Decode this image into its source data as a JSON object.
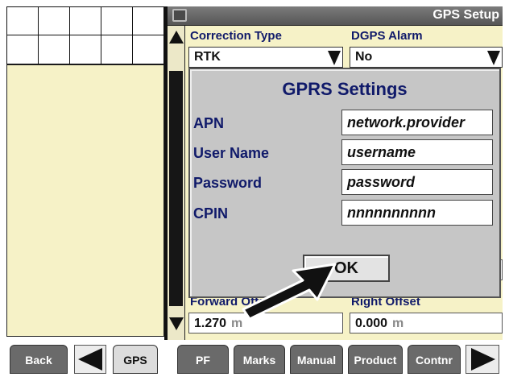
{
  "window": {
    "title": "GPS Setup",
    "title_icon": "screen-icon"
  },
  "main": {
    "correction_type": {
      "label": "Correction Type",
      "value": "RTK"
    },
    "dgps_alarm": {
      "label": "DGPS Alarm",
      "value": "No"
    },
    "forward_offset": {
      "label": "Forward Offset",
      "value": "1.270",
      "unit": "m"
    },
    "right_offset": {
      "label": "Right Offset",
      "value": "0.000",
      "unit": "m"
    }
  },
  "dialog": {
    "title": "GPRS Settings",
    "fields": [
      {
        "label": "APN",
        "value": "network.provider"
      },
      {
        "label": "User Name",
        "value": "username"
      },
      {
        "label": "Password",
        "value": "password"
      },
      {
        "label": "CPIN",
        "value": "nnnnnnnnnn"
      }
    ],
    "ok_label": "OK"
  },
  "bottom_bar": {
    "back": "Back",
    "gps": "GPS",
    "pf": "PF",
    "marks": "Marks",
    "manual": "Manual",
    "product": "Product",
    "contnr": "Contnr"
  }
}
